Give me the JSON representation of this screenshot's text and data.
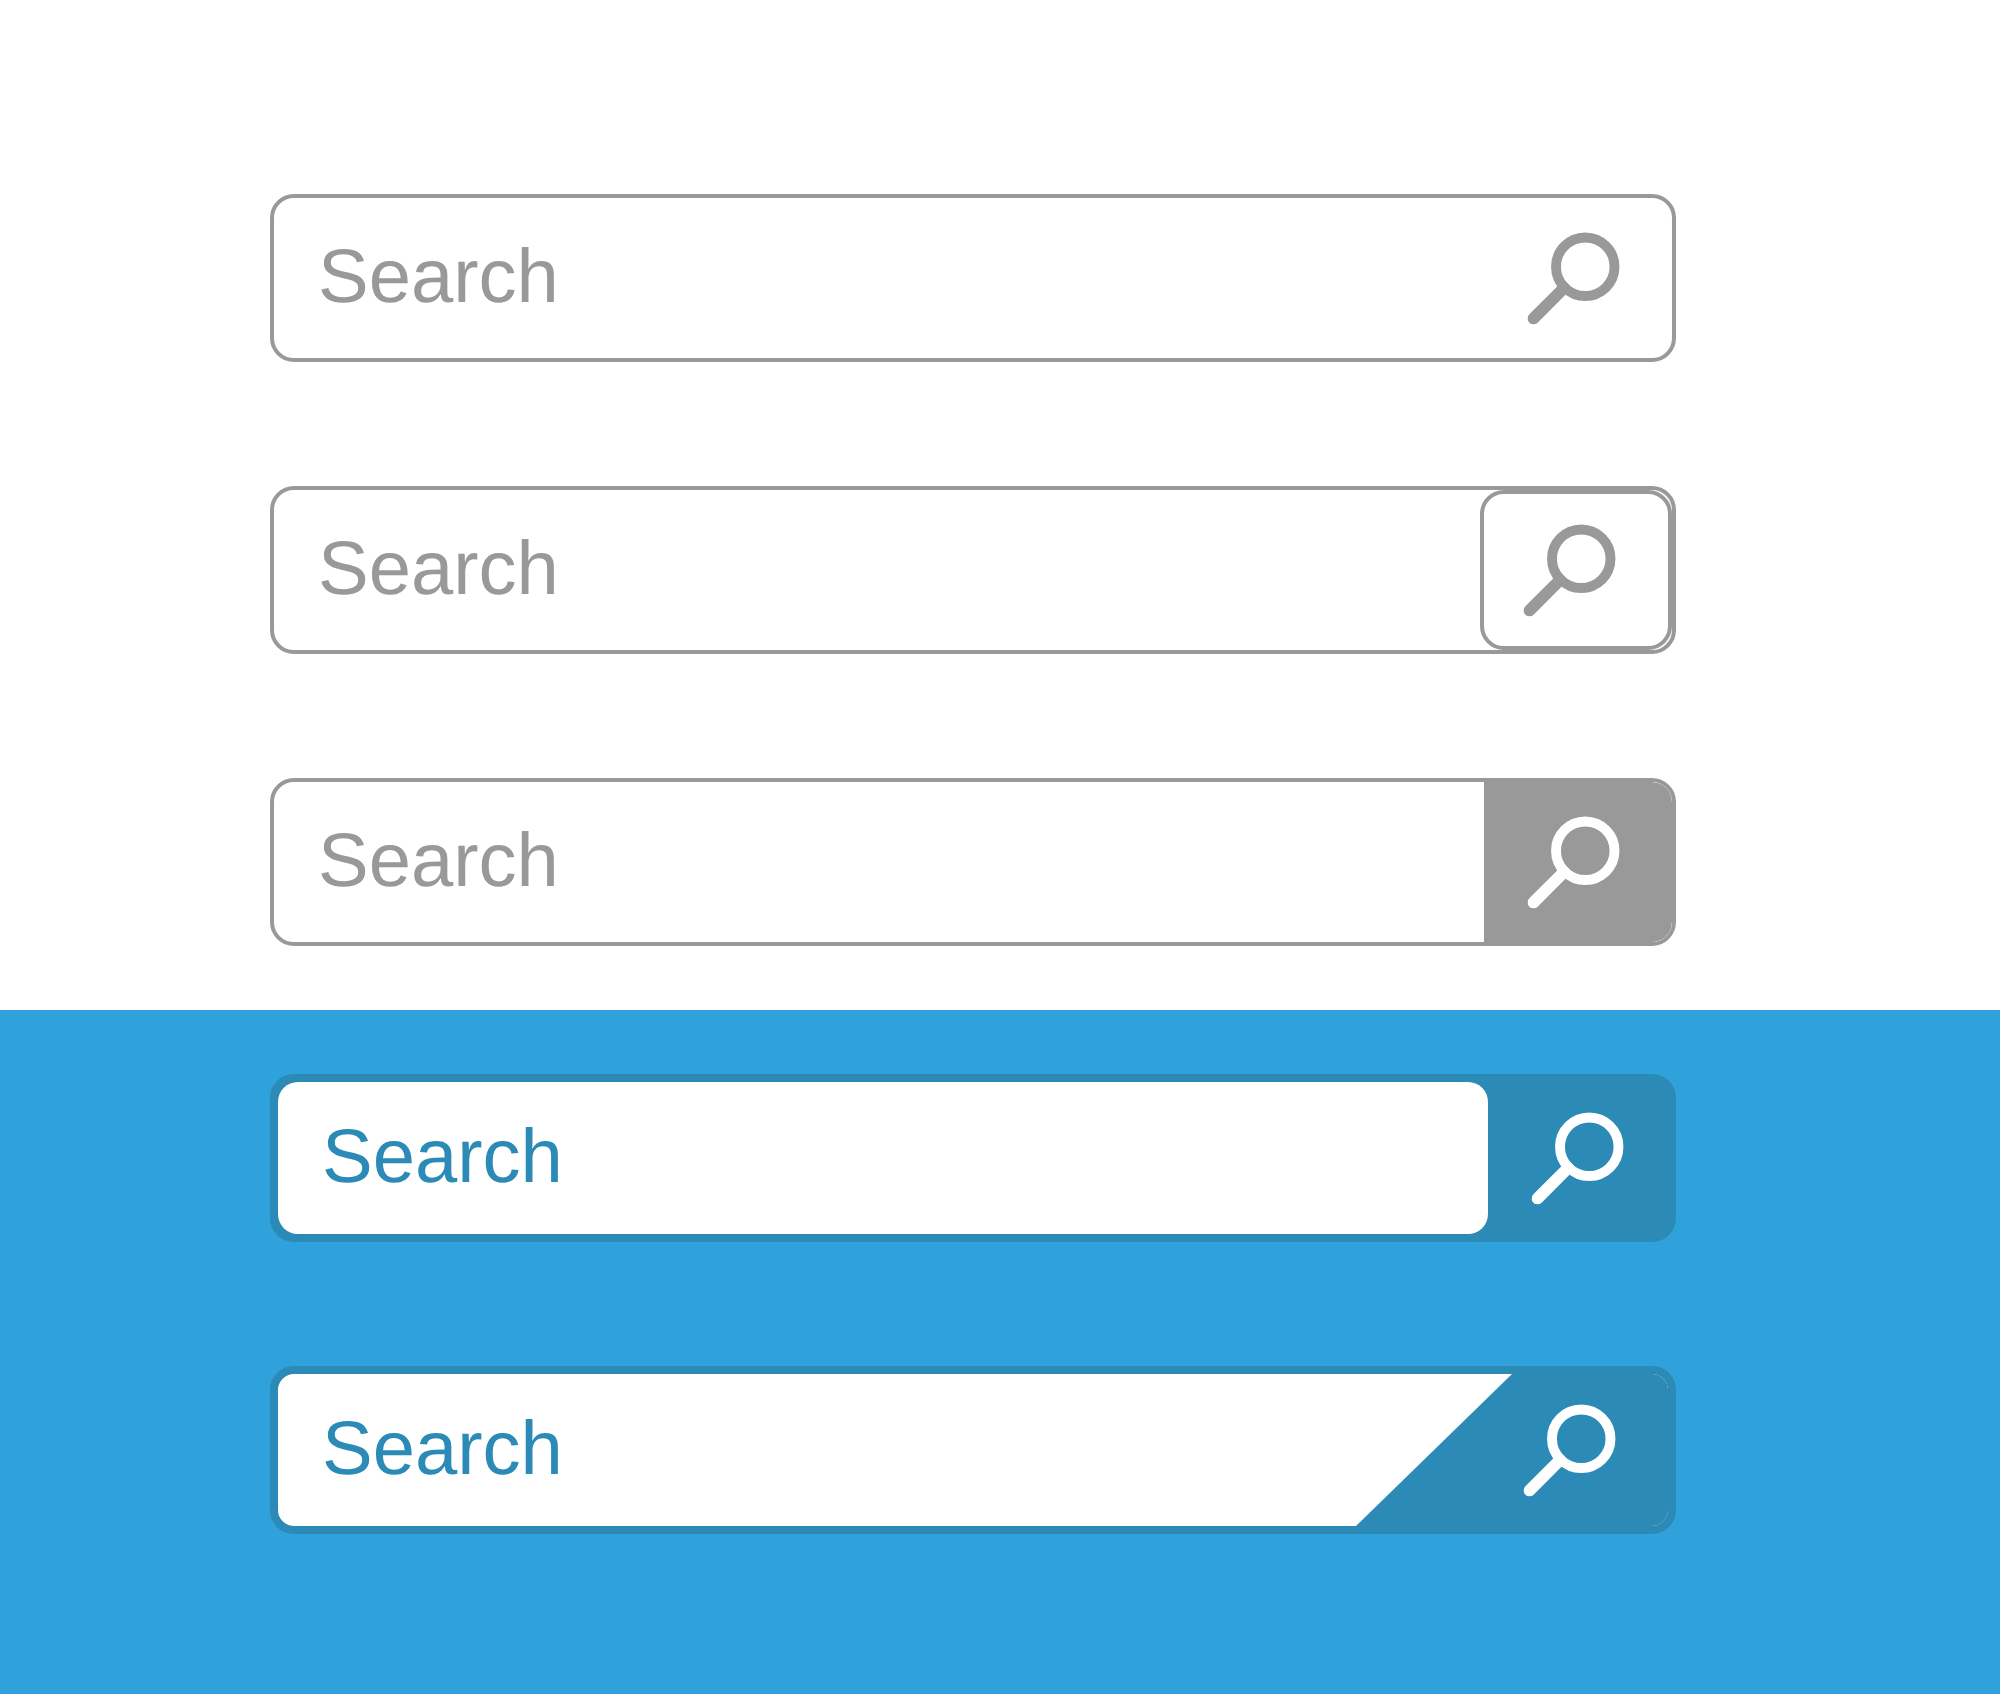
{
  "sections": [
    {
      "kind": "light",
      "bars": [
        {
          "kind": "plain-icon",
          "placeholder": "Search"
        },
        {
          "kind": "boxed-button",
          "placeholder": "Search"
        },
        {
          "kind": "filled-button",
          "placeholder": "Search"
        }
      ]
    },
    {
      "kind": "dark",
      "bars": [
        {
          "kind": "tab-button",
          "placeholder": "Search"
        },
        {
          "kind": "slanted-button",
          "placeholder": "Search"
        }
      ]
    }
  ]
}
